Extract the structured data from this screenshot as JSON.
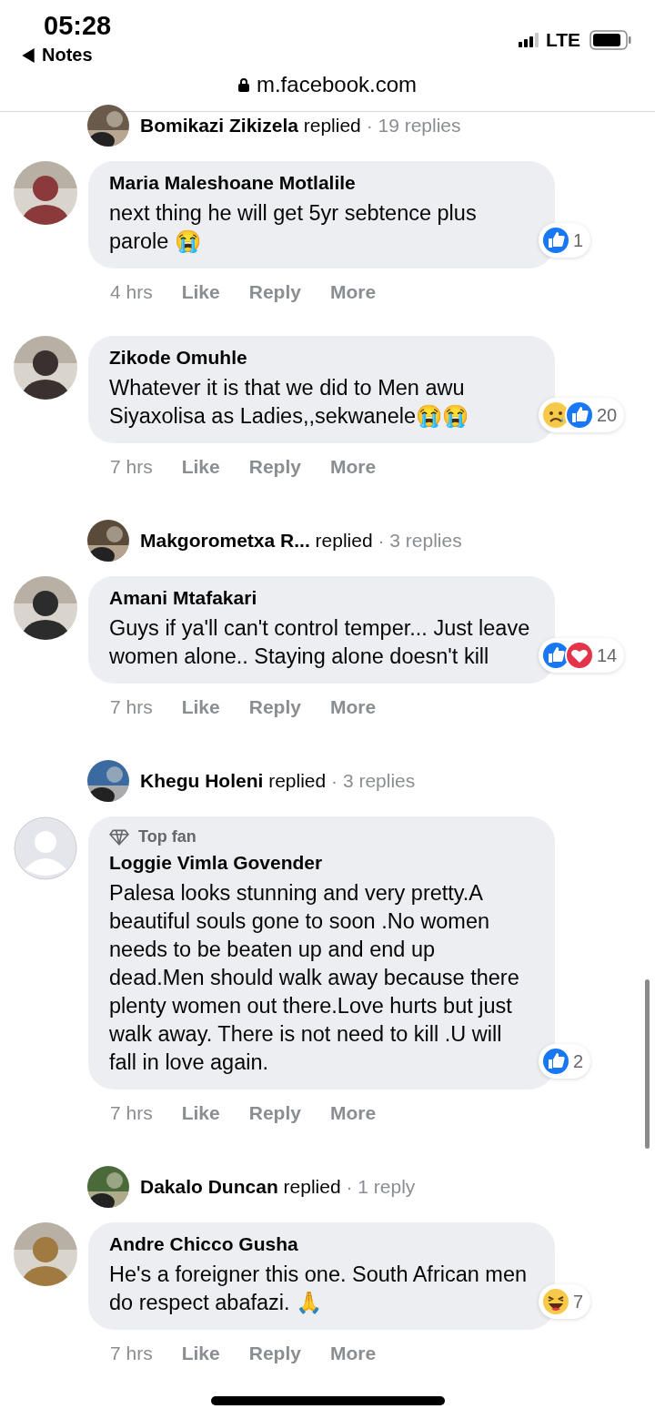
{
  "status_bar": {
    "time": "05:28",
    "back_label": "Notes",
    "network": "LTE"
  },
  "address_bar": {
    "url": "m.facebook.com",
    "secure": true
  },
  "thread": [
    {
      "kind": "reply_summary",
      "name": "Bomikazi Zikizela",
      "verb": "replied",
      "count": "· 19 replies"
    },
    {
      "kind": "comment",
      "default_avatar": false,
      "name": "Maria Maleshoane Motlalile",
      "text": "next thing he will get 5yr sebtence plus parole 😭",
      "reactions": [
        {
          "kind": "like"
        }
      ],
      "reaction_count": "1",
      "time": "4 hrs",
      "actions": [
        "Like",
        "Reply",
        "More"
      ]
    },
    {
      "kind": "comment",
      "default_avatar": false,
      "name": "Zikode Omuhle",
      "text": "Whatever it is that we did to Men awu Siyaxolisa as Ladies,,sekwanele😭😭",
      "reactions": [
        {
          "kind": "sad"
        },
        {
          "kind": "like"
        }
      ],
      "reaction_count": "20",
      "time": "7 hrs",
      "actions": [
        "Like",
        "Reply",
        "More"
      ]
    },
    {
      "kind": "reply_summary",
      "name": "Makgorometxa R...",
      "verb": "replied",
      "count": "· 3 replies"
    },
    {
      "kind": "comment",
      "default_avatar": false,
      "name": "Amani Mtafakari",
      "text": "Guys if ya'll can't control temper... Just leave women alone.. Staying alone doesn't kill",
      "reactions": [
        {
          "kind": "like"
        },
        {
          "kind": "love"
        }
      ],
      "reaction_count": "14",
      "time": "7 hrs",
      "actions": [
        "Like",
        "Reply",
        "More"
      ]
    },
    {
      "kind": "reply_summary",
      "name": "Khegu Holeni",
      "verb": "replied",
      "count": "· 3 replies"
    },
    {
      "kind": "comment",
      "default_avatar": true,
      "badge": "Top fan",
      "name": "Loggie Vimla Govender",
      "text": "Palesa looks stunning and very pretty.A beautiful souls gone to soon .No women needs to be beaten up and end up dead.Men should walk away because there plenty women out there.Love hurts but just walk away. There is not need to kill .U will fall in love again.",
      "reactions": [
        {
          "kind": "like"
        }
      ],
      "reaction_count": "2",
      "time": "7 hrs",
      "actions": [
        "Like",
        "Reply",
        "More"
      ]
    },
    {
      "kind": "reply_summary",
      "name": "Dakalo Duncan",
      "verb": "replied",
      "count": "· 1 reply"
    },
    {
      "kind": "comment",
      "default_avatar": false,
      "name": "Andre Chicco Gusha",
      "text": "He's a foreigner this one. South African men do respect abafazi. 🙏",
      "reactions": [
        {
          "kind": "haha"
        }
      ],
      "reaction_count": "7",
      "time": "7 hrs",
      "actions": [
        "Like",
        "Reply",
        "More"
      ]
    }
  ]
}
